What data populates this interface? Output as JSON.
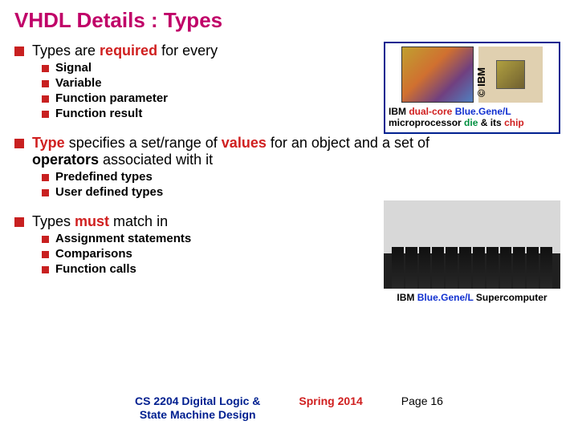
{
  "title": "VHDL Details : Types",
  "section1": {
    "lead_pre": "Types are ",
    "lead_req": "required",
    "lead_post": " for every",
    "items": [
      "Signal",
      "Variable",
      "Function parameter",
      "Function result"
    ]
  },
  "fig1": {
    "credit": "© IBM",
    "cap_pre": "IBM ",
    "cap_dual": "dual-core",
    "cap_bg": " Blue.Gene/L",
    "cap_line2_pre": "microprocessor ",
    "cap_die": "die",
    "cap_amp": " & its ",
    "cap_chip": "chip"
  },
  "section2": {
    "w_type": "Type",
    "t1": " specifies a set/range of ",
    "w_values": "values",
    "t2": " for an object and a set of ",
    "w_ops": "operators",
    "t3": " associated with it",
    "sub1": "Predefined types",
    "sub2": "User defined types"
  },
  "fig2": {
    "cap_pre": "IBM ",
    "cap_bg": "Blue.Gene/L",
    "cap_post": " Supercomputer"
  },
  "section3": {
    "lead_pre": "Types ",
    "lead_must": "must",
    "lead_post": " match in",
    "items": [
      "Assignment statements",
      "Comparisons",
      "Function calls"
    ]
  },
  "footer": {
    "course_l1": "CS 2204 Digital Logic &",
    "course_l2": "State Machine Design",
    "semester": "Spring 2014",
    "page": "Page 16"
  }
}
